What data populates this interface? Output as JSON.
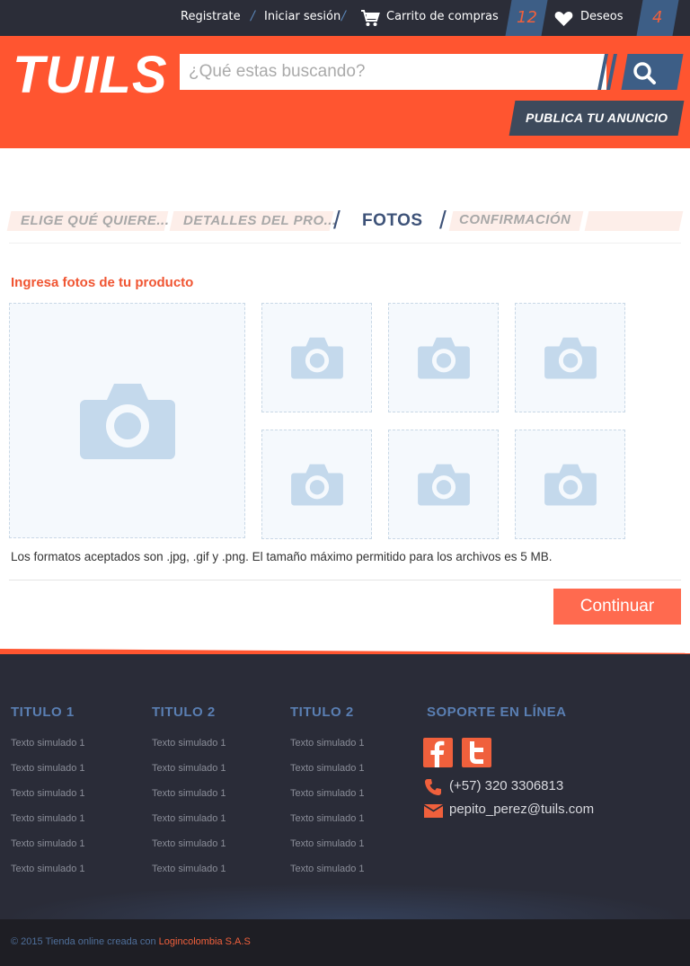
{
  "topbar": {
    "register_label": "Registrate",
    "login_label": "Iniciar sesión",
    "separator": "/",
    "cart_label": "Carrito de compras",
    "cart_count": "12",
    "wishlist_label": "Deseos",
    "wishlist_count": "4"
  },
  "header": {
    "logo": "TUILS",
    "search_placeholder": "¿Qué estas buscando?",
    "publish_label": "PUBLICA TU ANUNCIO"
  },
  "steps": {
    "items": [
      {
        "label": "ELIGE QUÉ QUIERE...",
        "state": "done"
      },
      {
        "label": "DETALLES DEL PRO...",
        "state": "done"
      },
      {
        "label": "FOTOS",
        "state": "active"
      },
      {
        "label": "CONFIRMACIÓN",
        "state": "pending"
      }
    ]
  },
  "photos": {
    "title": "Ingresa fotos de tu producto",
    "slot_count": 7,
    "note": "Los formatos aceptados son .jpg, .gif y .png. El tamaño máximo permitido para los archivos es 5 MB.",
    "continue_label": "Continuar"
  },
  "footer": {
    "columns": [
      {
        "title": "TITULO 1",
        "items": [
          "Texto simulado 1",
          "Texto simulado 1",
          "Texto simulado 1",
          "Texto simulado 1",
          "Texto simulado 1",
          "Texto simulado 1"
        ]
      },
      {
        "title": "TITULO 2",
        "items": [
          "Texto simulado 1",
          "Texto simulado 1",
          "Texto simulado 1",
          "Texto simulado 1",
          "Texto simulado 1",
          "Texto simulado 1"
        ]
      },
      {
        "title": "TITULO 2",
        "items": [
          "Texto simulado 1",
          "Texto simulado 1",
          "Texto simulado 1",
          "Texto simulado 1",
          "Texto simulado 1",
          "Texto simulado 1"
        ]
      }
    ],
    "support_title": "SOPORTE EN LÍNEA",
    "phone": "(+57) 320 3306813",
    "email": "pepito_perez@tuils.com",
    "copyright_prefix": "© 2015 Tienda online creada con ",
    "copyright_company": "Logincolombia S.A.S"
  },
  "colors": {
    "brand_orange": "#ff5530",
    "brand_blue": "#3d5e86",
    "footer_bg": "#2a2c38"
  }
}
